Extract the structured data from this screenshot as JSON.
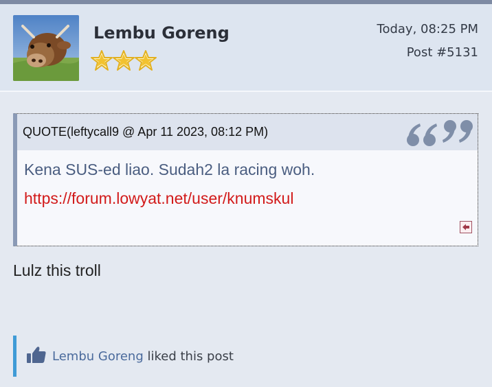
{
  "post": {
    "username": "Lembu Goreng",
    "date": "Today, 08:25 PM",
    "post_number": "Post #5131",
    "rank_stars": 3
  },
  "quote": {
    "title": "QUOTE(leftycall9 @ Apr 11 2023, 08:12 PM)",
    "line1": "Kena SUS-ed liao. Sudah2 la racing woh.",
    "link": "https://forum.lowyat.net/user/knumskul"
  },
  "body": {
    "text": "Lulz this troll"
  },
  "likes": {
    "user": "Lembu Goreng",
    "suffix": " liked this post"
  },
  "colors": {
    "link_red": "#d21a1a",
    "quote_text": "#4a5d80",
    "likes_accent": "#3f9bd6",
    "star_gold": "#f2c230"
  },
  "icons": {
    "stars": "star-icon",
    "quote": "quotation-marks-icon",
    "back": "back-to-quote-icon",
    "like": "thumbs-up-icon"
  }
}
